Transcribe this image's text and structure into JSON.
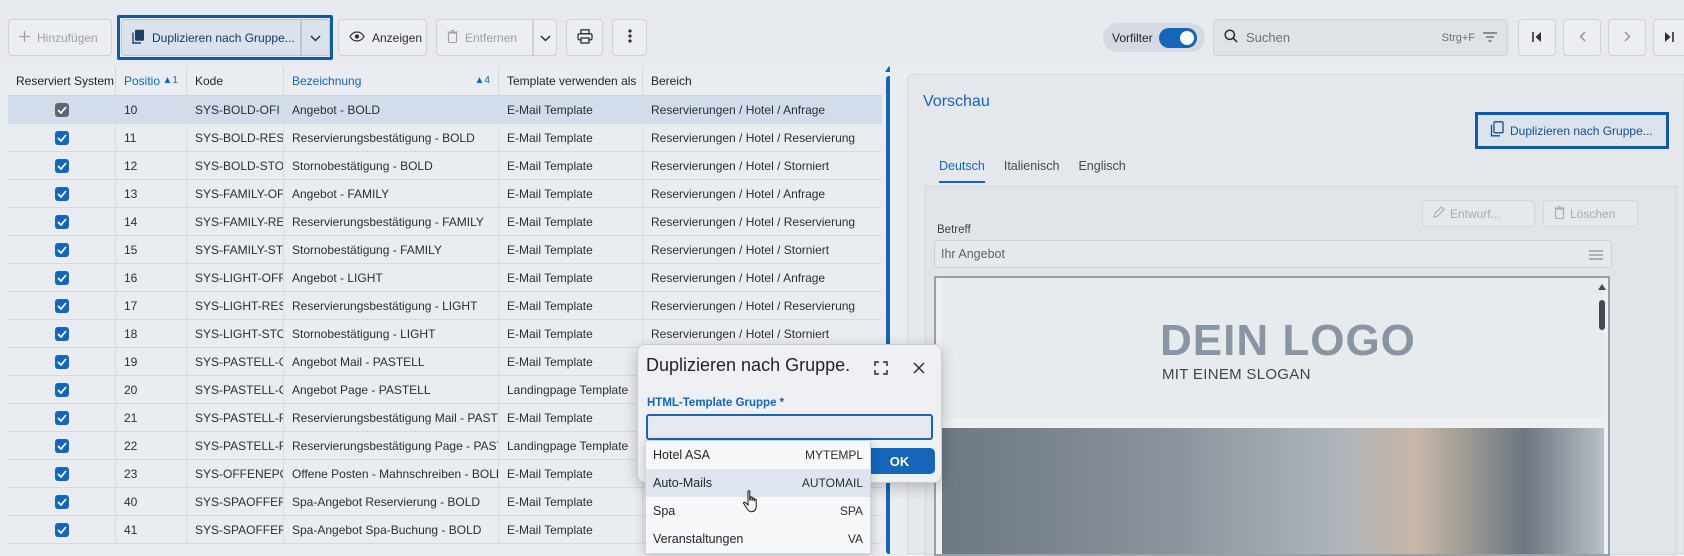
{
  "toolbar": {
    "add_label": "Hinzufügen",
    "duplicate_label": "Duplizieren nach Gruppe...",
    "show_label": "Anzeigen",
    "remove_label": "Entfernen",
    "prefilter_label": "Vorfilter",
    "search_placeholder": "Suchen",
    "search_shortcut": "Strg+F"
  },
  "grid": {
    "headers": [
      {
        "label": "Reserviert System",
        "sort": ""
      },
      {
        "label": "Positio",
        "sort": "▲1"
      },
      {
        "label": "Kode",
        "sort": ""
      },
      {
        "label": "Bezeichnung",
        "sort": "▲4"
      },
      {
        "label": "Template verwenden als",
        "sort": ""
      },
      {
        "label": "Bereich",
        "sort": ""
      }
    ],
    "rows": [
      {
        "pos": "10",
        "code": "SYS-BOLD-OFI",
        "name": "Angebot - BOLD",
        "usage": "E-Mail Template",
        "area": "Reservierungen / Hotel / Anfrage",
        "selected": true
      },
      {
        "pos": "11",
        "code": "SYS-BOLD-RESE",
        "name": "Reservierungsbestätigung - BOLD",
        "usage": "E-Mail Template",
        "area": "Reservierungen / Hotel / Reservierung"
      },
      {
        "pos": "12",
        "code": "SYS-BOLD-STOI",
        "name": "Stornobestätigung - BOLD",
        "usage": "E-Mail Template",
        "area": "Reservierungen / Hotel / Storniert"
      },
      {
        "pos": "13",
        "code": "SYS-FAMILY-OF",
        "name": "Angebot - FAMILY",
        "usage": "E-Mail Template",
        "area": "Reservierungen / Hotel / Anfrage"
      },
      {
        "pos": "14",
        "code": "SYS-FAMILY-RES",
        "name": "Reservierungsbestätigung - FAMILY",
        "usage": "E-Mail Template",
        "area": "Reservierungen / Hotel / Reservierung"
      },
      {
        "pos": "15",
        "code": "SYS-FAMILY-STO",
        "name": "Stornobestätigung - FAMILY",
        "usage": "E-Mail Template",
        "area": "Reservierungen / Hotel / Storniert"
      },
      {
        "pos": "16",
        "code": "SYS-LIGHT-OFFI",
        "name": "Angebot - LIGHT",
        "usage": "E-Mail Template",
        "area": "Reservierungen / Hotel / Anfrage"
      },
      {
        "pos": "17",
        "code": "SYS-LIGHT-RESI",
        "name": "Reservierungsbestätigung - LIGHT",
        "usage": "E-Mail Template",
        "area": "Reservierungen / Hotel / Reservierung"
      },
      {
        "pos": "18",
        "code": "SYS-LIGHT-STO",
        "name": "Stornobestätigung - LIGHT",
        "usage": "E-Mail Template",
        "area": "Reservierungen / Hotel / Storniert"
      },
      {
        "pos": "19",
        "code": "SYS-PASTELL-O",
        "name": "Angebot Mail - PASTELL",
        "usage": "E-Mail Template",
        "area": ""
      },
      {
        "pos": "20",
        "code": "SYS-PASTELL-O",
        "name": "Angebot Page - PASTELL",
        "usage": "Landingpage Template",
        "area": ""
      },
      {
        "pos": "21",
        "code": "SYS-PASTELL-RI",
        "name": "Reservierungsbestätigung Mail - PASTELL",
        "usage": "E-Mail Template",
        "area": ""
      },
      {
        "pos": "22",
        "code": "SYS-PASTELL-RI",
        "name": "Reservierungsbestätigung Page - PASTELL",
        "usage": "Landingpage Template",
        "area": ""
      },
      {
        "pos": "23",
        "code": "SYS-OFFENEPO",
        "name": "Offene Posten - Mahnschreiben - BOLD",
        "usage": "E-Mail Template",
        "area": ""
      },
      {
        "pos": "40",
        "code": "SYS-SPAOFFER_",
        "name": "Spa-Angebot Reservierung - BOLD",
        "usage": "E-Mail Template",
        "area": ""
      },
      {
        "pos": "41",
        "code": "SYS-SPAOFFER_",
        "name": "Spa-Angebot Spa-Buchung - BOLD",
        "usage": "E-Mail Template",
        "area": ""
      }
    ]
  },
  "preview": {
    "title": "Vorschau",
    "duplicate_label": "Duplizieren nach Gruppe...",
    "tabs": [
      "Deutsch",
      "Italienisch",
      "Englisch"
    ],
    "draft_label": "Entwurf...",
    "delete_label": "Löschen",
    "subject_label": "Betreff",
    "subject_value": "Ihr Angebot",
    "logo_text": "DEIN LOGO",
    "slogan_text": "MIT EINEM SLOGAN"
  },
  "dialog": {
    "title": "Duplizieren nach Gruppe...",
    "field_label": "HTML-Template Gruppe *",
    "field_value": "",
    "ok_label": "OK",
    "options": [
      {
        "label": "Hotel ASA",
        "code": "MYTEMPL"
      },
      {
        "label": "Auto-Mails",
        "code": "AUTOMAIL"
      },
      {
        "label": "Spa",
        "code": "SPA"
      },
      {
        "label": "Veranstaltungen",
        "code": "VA"
      }
    ]
  },
  "colors": {
    "accent": "#1565b8",
    "focus": "#0f5aa8",
    "background": "#e9ecf0"
  }
}
